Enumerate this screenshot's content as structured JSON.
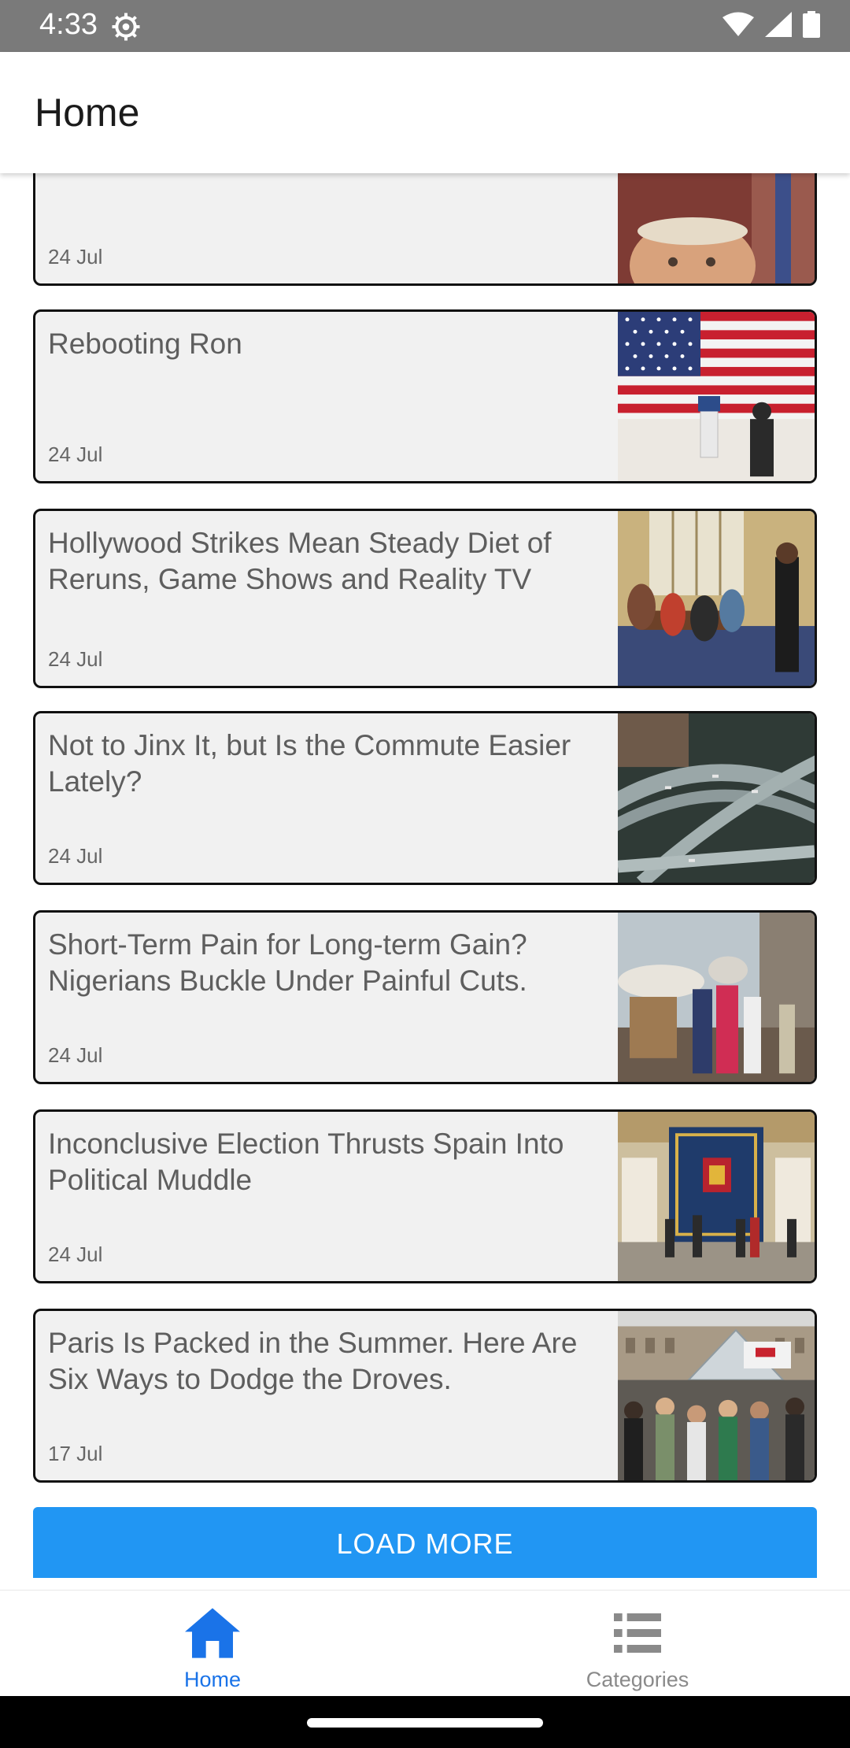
{
  "status_bar": {
    "time": "4:33"
  },
  "app_bar": {
    "title": "Home"
  },
  "articles": [
    {
      "headline": "",
      "date": "24 Jul"
    },
    {
      "headline": "Rebooting Ron",
      "date": "24 Jul"
    },
    {
      "headline": "Hollywood Strikes Mean Steady Diet of Reruns, Game Shows and Reality TV",
      "date": "24 Jul"
    },
    {
      "headline": "Not to Jinx It, but Is the Commute Easier Lately?",
      "date": "24 Jul"
    },
    {
      "headline": "Short-Term Pain for Long-term Gain? Nigerians Buckle Under Painful Cuts.",
      "date": "24 Jul"
    },
    {
      "headline": "Inconclusive Election Thrusts Spain Into Political Muddle",
      "date": "24 Jul"
    },
    {
      "headline": "Paris Is Packed in the Summer. Here Are Six Ways to Dodge the Droves.",
      "date": "17 Jul"
    }
  ],
  "load_more": {
    "label": "LOAD MORE"
  },
  "bottom_nav": {
    "home": {
      "label": "Home",
      "icon": "home-icon",
      "active": true
    },
    "categories": {
      "label": "Categories",
      "icon": "list-icon",
      "active": false
    }
  },
  "colors": {
    "accent": "#2196f3",
    "active_nav": "#1a73e8",
    "inactive_nav": "#8a8a8a",
    "card_bg": "#f1f1f1"
  }
}
